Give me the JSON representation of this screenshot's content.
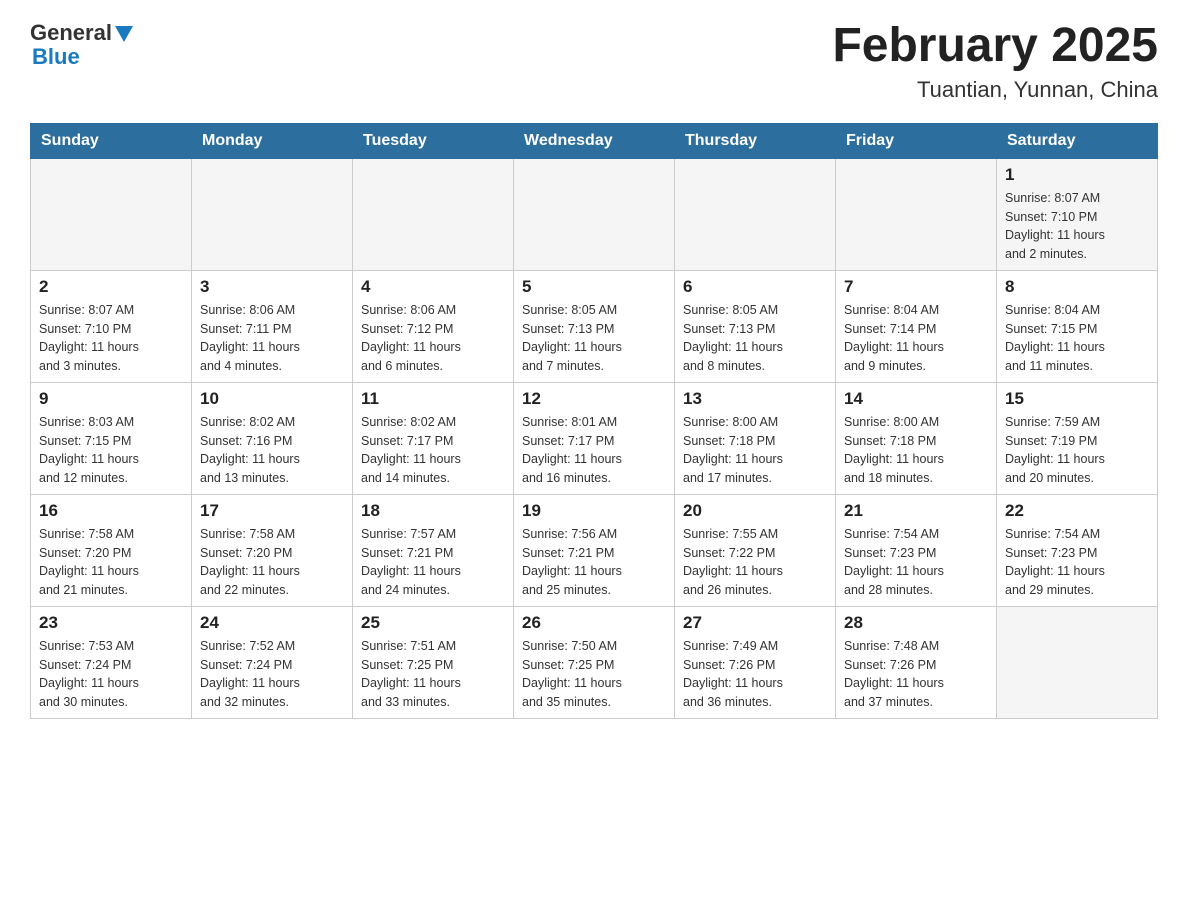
{
  "header": {
    "logo": {
      "general_text": "General",
      "blue_text": "Blue"
    },
    "month_title": "February 2025",
    "location": "Tuantian, Yunnan, China"
  },
  "weekdays": [
    "Sunday",
    "Monday",
    "Tuesday",
    "Wednesday",
    "Thursday",
    "Friday",
    "Saturday"
  ],
  "weeks": [
    [
      {
        "day": "",
        "info": ""
      },
      {
        "day": "",
        "info": ""
      },
      {
        "day": "",
        "info": ""
      },
      {
        "day": "",
        "info": ""
      },
      {
        "day": "",
        "info": ""
      },
      {
        "day": "",
        "info": ""
      },
      {
        "day": "1",
        "info": "Sunrise: 8:07 AM\nSunset: 7:10 PM\nDaylight: 11 hours\nand 2 minutes."
      }
    ],
    [
      {
        "day": "2",
        "info": "Sunrise: 8:07 AM\nSunset: 7:10 PM\nDaylight: 11 hours\nand 3 minutes."
      },
      {
        "day": "3",
        "info": "Sunrise: 8:06 AM\nSunset: 7:11 PM\nDaylight: 11 hours\nand 4 minutes."
      },
      {
        "day": "4",
        "info": "Sunrise: 8:06 AM\nSunset: 7:12 PM\nDaylight: 11 hours\nand 6 minutes."
      },
      {
        "day": "5",
        "info": "Sunrise: 8:05 AM\nSunset: 7:13 PM\nDaylight: 11 hours\nand 7 minutes."
      },
      {
        "day": "6",
        "info": "Sunrise: 8:05 AM\nSunset: 7:13 PM\nDaylight: 11 hours\nand 8 minutes."
      },
      {
        "day": "7",
        "info": "Sunrise: 8:04 AM\nSunset: 7:14 PM\nDaylight: 11 hours\nand 9 minutes."
      },
      {
        "day": "8",
        "info": "Sunrise: 8:04 AM\nSunset: 7:15 PM\nDaylight: 11 hours\nand 11 minutes."
      }
    ],
    [
      {
        "day": "9",
        "info": "Sunrise: 8:03 AM\nSunset: 7:15 PM\nDaylight: 11 hours\nand 12 minutes."
      },
      {
        "day": "10",
        "info": "Sunrise: 8:02 AM\nSunset: 7:16 PM\nDaylight: 11 hours\nand 13 minutes."
      },
      {
        "day": "11",
        "info": "Sunrise: 8:02 AM\nSunset: 7:17 PM\nDaylight: 11 hours\nand 14 minutes."
      },
      {
        "day": "12",
        "info": "Sunrise: 8:01 AM\nSunset: 7:17 PM\nDaylight: 11 hours\nand 16 minutes."
      },
      {
        "day": "13",
        "info": "Sunrise: 8:00 AM\nSunset: 7:18 PM\nDaylight: 11 hours\nand 17 minutes."
      },
      {
        "day": "14",
        "info": "Sunrise: 8:00 AM\nSunset: 7:18 PM\nDaylight: 11 hours\nand 18 minutes."
      },
      {
        "day": "15",
        "info": "Sunrise: 7:59 AM\nSunset: 7:19 PM\nDaylight: 11 hours\nand 20 minutes."
      }
    ],
    [
      {
        "day": "16",
        "info": "Sunrise: 7:58 AM\nSunset: 7:20 PM\nDaylight: 11 hours\nand 21 minutes."
      },
      {
        "day": "17",
        "info": "Sunrise: 7:58 AM\nSunset: 7:20 PM\nDaylight: 11 hours\nand 22 minutes."
      },
      {
        "day": "18",
        "info": "Sunrise: 7:57 AM\nSunset: 7:21 PM\nDaylight: 11 hours\nand 24 minutes."
      },
      {
        "day": "19",
        "info": "Sunrise: 7:56 AM\nSunset: 7:21 PM\nDaylight: 11 hours\nand 25 minutes."
      },
      {
        "day": "20",
        "info": "Sunrise: 7:55 AM\nSunset: 7:22 PM\nDaylight: 11 hours\nand 26 minutes."
      },
      {
        "day": "21",
        "info": "Sunrise: 7:54 AM\nSunset: 7:23 PM\nDaylight: 11 hours\nand 28 minutes."
      },
      {
        "day": "22",
        "info": "Sunrise: 7:54 AM\nSunset: 7:23 PM\nDaylight: 11 hours\nand 29 minutes."
      }
    ],
    [
      {
        "day": "23",
        "info": "Sunrise: 7:53 AM\nSunset: 7:24 PM\nDaylight: 11 hours\nand 30 minutes."
      },
      {
        "day": "24",
        "info": "Sunrise: 7:52 AM\nSunset: 7:24 PM\nDaylight: 11 hours\nand 32 minutes."
      },
      {
        "day": "25",
        "info": "Sunrise: 7:51 AM\nSunset: 7:25 PM\nDaylight: 11 hours\nand 33 minutes."
      },
      {
        "day": "26",
        "info": "Sunrise: 7:50 AM\nSunset: 7:25 PM\nDaylight: 11 hours\nand 35 minutes."
      },
      {
        "day": "27",
        "info": "Sunrise: 7:49 AM\nSunset: 7:26 PM\nDaylight: 11 hours\nand 36 minutes."
      },
      {
        "day": "28",
        "info": "Sunrise: 7:48 AM\nSunset: 7:26 PM\nDaylight: 11 hours\nand 37 minutes."
      },
      {
        "day": "",
        "info": ""
      }
    ]
  ]
}
